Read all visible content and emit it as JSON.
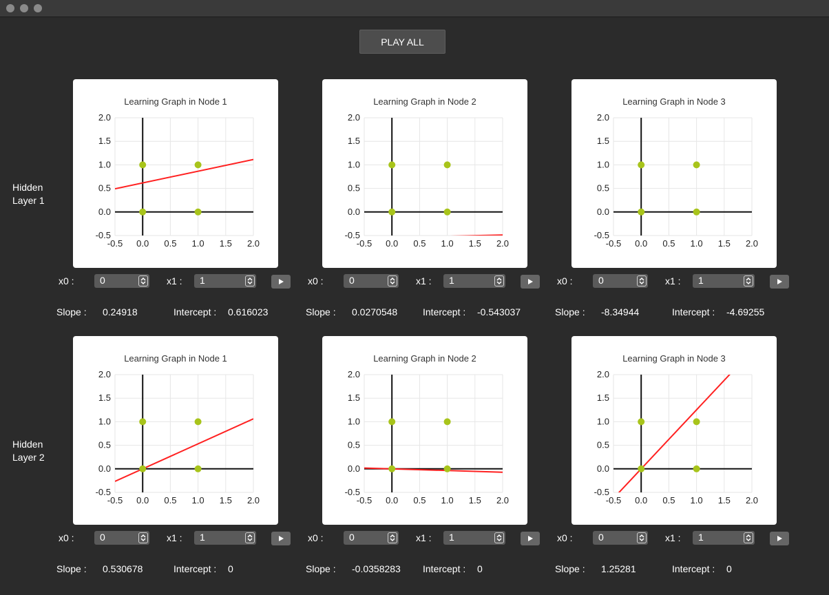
{
  "window": {
    "play_all_label": "PLAY ALL"
  },
  "layers": [
    {
      "label_line1": "Hidden",
      "label_line2": "Layer 1",
      "nodes": [
        {
          "title": "Learning Graph in Node 1",
          "x0": "0",
          "x1": "1",
          "slope": "0.24918",
          "intercept": "0.616023"
        },
        {
          "title": "Learning Graph in Node 2",
          "x0": "0",
          "x1": "1",
          "slope": "0.0270548",
          "intercept": "-0.543037"
        },
        {
          "title": "Learning Graph in Node 3",
          "x0": "0",
          "x1": "1",
          "slope": "-8.34944",
          "intercept": "-4.69255"
        }
      ]
    },
    {
      "label_line1": "Hidden",
      "label_line2": "Layer 2",
      "nodes": [
        {
          "title": "Learning Graph in Node 1",
          "x0": "0",
          "x1": "1",
          "slope": "0.530678",
          "intercept": "0"
        },
        {
          "title": "Learning Graph in Node 2",
          "x0": "0",
          "x1": "1",
          "slope": "-0.0358283",
          "intercept": "0"
        },
        {
          "title": "Learning Graph in Node 3",
          "x0": "0",
          "x1": "1",
          "slope": "1.25281",
          "intercept": "0"
        }
      ]
    }
  ],
  "labels": {
    "x0": "x0 :",
    "x1": "x1 :",
    "slope": "Slope :",
    "intercept": "Intercept :"
  },
  "chart_data": [
    {
      "type": "scatter",
      "title": "Learning Graph in Node 1",
      "xlim": [
        -0.5,
        2.0
      ],
      "ylim": [
        -0.5,
        2.0
      ],
      "x_ticks": [
        "-0.5",
        "0.0",
        "0.5",
        "1.0",
        "1.5",
        "2.0"
      ],
      "y_ticks": [
        "2.0",
        "1.5",
        "1.0",
        "0.5",
        "0.0",
        "-0.5"
      ],
      "points": [
        [
          0,
          0
        ],
        [
          0,
          1
        ],
        [
          1,
          0
        ],
        [
          1,
          1
        ]
      ],
      "line": {
        "slope": 0.24918,
        "intercept": 0.616023
      },
      "grid": true
    },
    {
      "type": "scatter",
      "title": "Learning Graph in Node 2",
      "xlim": [
        -0.5,
        2.0
      ],
      "ylim": [
        -0.5,
        2.0
      ],
      "x_ticks": [
        "-0.5",
        "0.0",
        "0.5",
        "1.0",
        "1.5",
        "2.0"
      ],
      "y_ticks": [
        "2.0",
        "1.5",
        "1.0",
        "0.5",
        "0.0",
        "-0.5"
      ],
      "points": [
        [
          0,
          0
        ],
        [
          0,
          1
        ],
        [
          1,
          0
        ],
        [
          1,
          1
        ]
      ],
      "line": {
        "slope": 0.0270548,
        "intercept": -0.543037
      },
      "grid": true
    },
    {
      "type": "scatter",
      "title": "Learning Graph in Node 3",
      "xlim": [
        -0.5,
        2.0
      ],
      "ylim": [
        -0.5,
        2.0
      ],
      "x_ticks": [
        "-0.5",
        "0.0",
        "0.5",
        "1.0",
        "1.5",
        "2.0"
      ],
      "y_ticks": [
        "2.0",
        "1.5",
        "1.0",
        "0.5",
        "0.0",
        "-0.5"
      ],
      "points": [
        [
          0,
          0
        ],
        [
          0,
          1
        ],
        [
          1,
          0
        ],
        [
          1,
          1
        ]
      ],
      "line": null,
      "grid": true
    },
    {
      "type": "scatter",
      "title": "Learning Graph in Node 1",
      "xlim": [
        -0.5,
        2.0
      ],
      "ylim": [
        -0.5,
        2.0
      ],
      "x_ticks": [
        "-0.5",
        "0.0",
        "0.5",
        "1.0",
        "1.5",
        "2.0"
      ],
      "y_ticks": [
        "2.0",
        "1.5",
        "1.0",
        "0.5",
        "0.0",
        "-0.5"
      ],
      "points": [
        [
          0,
          0
        ],
        [
          0,
          1
        ],
        [
          1,
          0
        ],
        [
          1,
          1
        ]
      ],
      "line": {
        "slope": 0.530678,
        "intercept": 0
      },
      "grid": true
    },
    {
      "type": "scatter",
      "title": "Learning Graph in Node 2",
      "xlim": [
        -0.5,
        2.0
      ],
      "ylim": [
        -0.5,
        2.0
      ],
      "x_ticks": [
        "-0.5",
        "0.0",
        "0.5",
        "1.0",
        "1.5",
        "2.0"
      ],
      "y_ticks": [
        "2.0",
        "1.5",
        "1.0",
        "0.5",
        "0.0",
        "-0.5"
      ],
      "points": [
        [
          0,
          0
        ],
        [
          0,
          1
        ],
        [
          1,
          0
        ],
        [
          1,
          1
        ]
      ],
      "line": {
        "slope": -0.0358283,
        "intercept": 0
      },
      "grid": true
    },
    {
      "type": "scatter",
      "title": "Learning Graph in Node 3",
      "xlim": [
        -0.5,
        2.0
      ],
      "ylim": [
        -0.5,
        2.0
      ],
      "x_ticks": [
        "-0.5",
        "0.0",
        "0.5",
        "1.0",
        "1.5",
        "2.0"
      ],
      "y_ticks": [
        "2.0",
        "1.5",
        "1.0",
        "0.5",
        "0.0",
        "-0.5"
      ],
      "points": [
        [
          0,
          0
        ],
        [
          0,
          1
        ],
        [
          1,
          0
        ],
        [
          1,
          1
        ]
      ],
      "line": {
        "slope": 1.25281,
        "intercept": 0
      },
      "grid": true
    }
  ],
  "colors": {
    "point": "#a8c41b",
    "line": "#ff2020",
    "axis": "#111111",
    "grid": "#e6e6e6"
  }
}
